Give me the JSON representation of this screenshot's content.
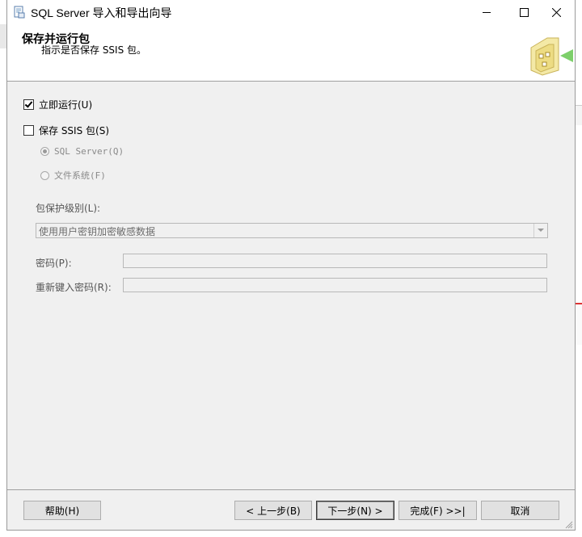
{
  "window": {
    "title": "SQL Server 导入和导出向导"
  },
  "header": {
    "title": "保存并运行包",
    "subtitle": "指示是否保存 SSIS 包。"
  },
  "options": {
    "run_now": {
      "label": "立即运行(U)",
      "checked": true
    },
    "save_ssis": {
      "label": "保存 SSIS 包(S)",
      "checked": false
    },
    "sql_server": {
      "label": "SQL Server(Q)",
      "selected": true,
      "enabled": false
    },
    "file_system": {
      "label": "文件系统(F)",
      "selected": false,
      "enabled": false
    }
  },
  "protection": {
    "label": "包保护级别(L):",
    "selected_value": "使用用户密钥加密敏感数据"
  },
  "password": {
    "label": "密码(P):",
    "value": ""
  },
  "retype_password": {
    "label": "重新键入密码(R):",
    "value": ""
  },
  "buttons": {
    "help": "帮助(H)",
    "back": "< 上一步(B)",
    "next": "下一步(N) >",
    "finish": "完成(F) >>|",
    "cancel": "取消"
  }
}
